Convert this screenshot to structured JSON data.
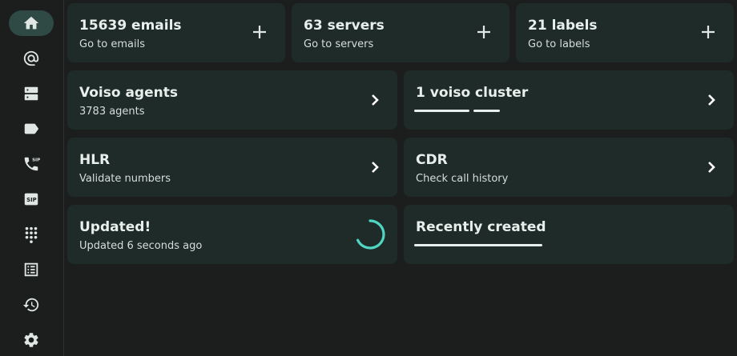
{
  "sidebar": {
    "items": [
      {
        "icon": "home-icon",
        "active": true
      },
      {
        "icon": "at-sign-icon"
      },
      {
        "icon": "servers-icon"
      },
      {
        "icon": "label-icon"
      },
      {
        "icon": "sip-phone-icon"
      },
      {
        "icon": "sip-badge-icon"
      },
      {
        "icon": "dialpad-icon"
      },
      {
        "icon": "list-icon"
      },
      {
        "icon": "history-icon"
      },
      {
        "icon": "settings-icon"
      }
    ]
  },
  "cards": {
    "emails": {
      "title": "15639 emails",
      "subtitle": "Go to emails"
    },
    "servers": {
      "title": "63 servers",
      "subtitle": "Go to servers"
    },
    "labels": {
      "title": "21 labels",
      "subtitle": "Go to labels"
    },
    "voiso_agents": {
      "title": "Voiso agents",
      "subtitle": "3783 agents"
    },
    "voiso_cluster": {
      "title": "1 voiso cluster"
    },
    "hlr": {
      "title": "HLR",
      "subtitle": "Validate numbers"
    },
    "cdr": {
      "title": "CDR",
      "subtitle": "Check call history"
    },
    "updated": {
      "title": "Updated!",
      "subtitle": "Updated 6 seconds ago"
    },
    "recently_created": {
      "title": "Recently created"
    }
  },
  "colors": {
    "background": "#1c1e1e",
    "card": "#1f2b29",
    "active_nav": "#2f4a44",
    "spinner": "#4fd6c2"
  }
}
